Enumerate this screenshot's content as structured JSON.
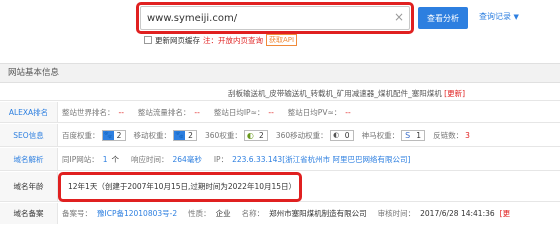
{
  "search": {
    "value": "www.symeiji.com/",
    "clear_icon": "×",
    "button": "查看分析",
    "history": "查询记录",
    "history_caret": "▼"
  },
  "options": {
    "update_cache": "更新网页缓存",
    "note": "注：开放内页查询",
    "api": "获取API"
  },
  "section": {
    "title": "网站基本信息"
  },
  "keywords": {
    "text": "刮板输送机_皮带输送机_转载机_矿用减速器_煤机配件_塞阳煤机",
    "update": "[更新]"
  },
  "alexa": {
    "label": "ALEXA排名",
    "world_rank_label": "整站世界排名：",
    "world_rank": "--",
    "traffic_rank_label": "整站流量排名：",
    "traffic_rank": "--",
    "ip_label": "整站日均IP≈：",
    "ip": "--",
    "pv_label": "整站日均PV≈：",
    "pv": "--"
  },
  "seo": {
    "label": "SEO信息",
    "items": [
      {
        "name": "百度权重：",
        "icon": "🐾",
        "value": "2"
      },
      {
        "name": "移动权重：",
        "icon": "🐾",
        "value": "2"
      },
      {
        "name": "360权重：",
        "icon": "◐",
        "value": "2"
      },
      {
        "name": "360移动权重：",
        "icon": "◐",
        "value": "0"
      },
      {
        "name": "神马权重：",
        "icon": "S",
        "value": "1"
      }
    ],
    "backlinks_label": "反链数：",
    "backlinks": "3"
  },
  "resolve": {
    "label": "域名解析",
    "sites_label": "同IP网站：",
    "sites": "1",
    "sites_unit": "个",
    "response_label": "响应时间：",
    "response": "264毫秒",
    "ip_label": "IP：",
    "ip": "223.6.33.143[浙江省杭州市 阿里巴巴网络有限公司]"
  },
  "age": {
    "label": "域名年龄",
    "text": "12年1天（创建于2007年10月15日,过期时间为2022年10月15日）"
  },
  "filing": {
    "label": "域名备案",
    "no_label": "备案号：",
    "no": "豫ICP备12010803号-2",
    "nature_label": "性质：",
    "nature": "企业",
    "name_label": "名称：",
    "name": "郑州市塞阳煤机制造有限公司",
    "time_label": "审核时间：",
    "time": "2017/6/28 14:41:36",
    "update": "[更"
  }
}
